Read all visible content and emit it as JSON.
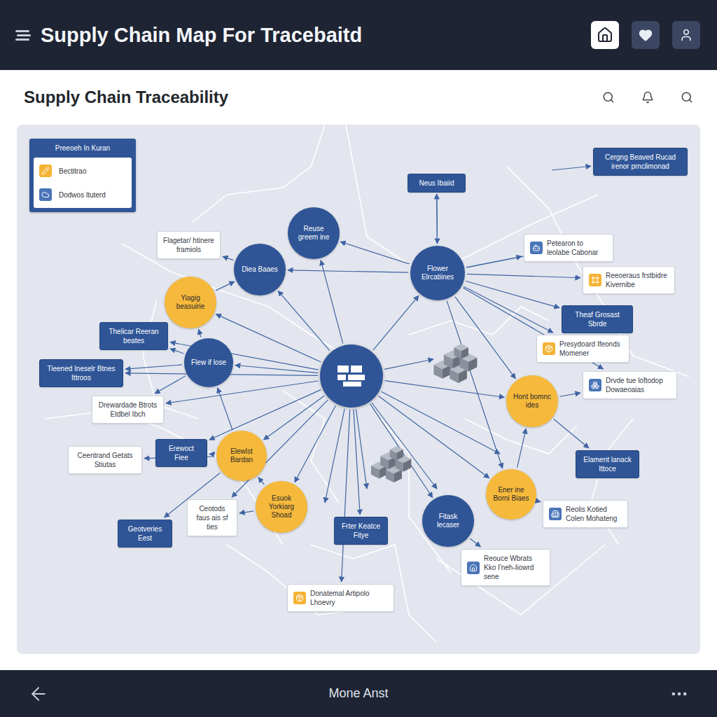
{
  "header": {
    "title": "Supply Chain Map For Tracebaitd"
  },
  "page": {
    "title": "Supply Chain Traceability"
  },
  "legend": {
    "title": "Preeoeh In Kuran",
    "items": [
      {
        "label": "Bectitrao",
        "color": "#f5b335"
      },
      {
        "label": "Dodwos ltuterd",
        "color": "#4a74b8"
      }
    ]
  },
  "circles": [
    {
      "label": "Reuse greem ine",
      "color": "#2f5597"
    },
    {
      "label": "Diea Baaes",
      "color": "#2f5597"
    },
    {
      "label": "Flower Elrcatiines",
      "color": "#2f5597"
    },
    {
      "label": "Yiagig beasuirie",
      "color": "#f6b93b"
    },
    {
      "label": "Flew if lose",
      "color": "#2f5597"
    },
    {
      "label": "Hont bomnc ides",
      "color": "#f6b93b"
    },
    {
      "label": "Elewlst Bardan",
      "color": "#f6b93b"
    },
    {
      "label": "Esuok Yorkiarg Shoad",
      "color": "#f6b93b"
    },
    {
      "label": "Ener ine Borni Biaes",
      "color": "#f6b93b"
    },
    {
      "label": "Fitask lecaser",
      "color": "#2f5597"
    }
  ],
  "labels": [
    {
      "text": "Neus Ibaiid",
      "kind": "dark"
    },
    {
      "text": "Cergng Beaved Rucad irenor prnclimonad",
      "kind": "dark"
    },
    {
      "text": "Flagetar/ htinere framiols",
      "kind": "plain"
    },
    {
      "text": "Petearon to leolabe Cabonar",
      "kind": "icon",
      "color": "#4a74b8"
    },
    {
      "text": "Reeoeraus frstbidre Kivernibe",
      "kind": "icon",
      "color": "#f5b335"
    },
    {
      "text": "Theaf Grosast Sbrde",
      "kind": "dark"
    },
    {
      "text": "Thelicar Reeran beates",
      "kind": "dark"
    },
    {
      "text": "Tieened Ineselr Btnes Ittroos",
      "kind": "dark"
    },
    {
      "text": "Presydoard Ifeonds Momener",
      "kind": "icon",
      "color": "#f5b335"
    },
    {
      "text": "Drvde tue loftodop Dowaeoaias",
      "kind": "icon",
      "color": "#4a74b8"
    },
    {
      "text": "Drewardade Btrots Etdbel Ibch",
      "kind": "plain"
    },
    {
      "text": "Erewoct Fiee",
      "kind": "dark"
    },
    {
      "text": "Ceentrand Getats Stiutas",
      "kind": "plain"
    },
    {
      "text": "Elament lanack Ittoce",
      "kind": "dark"
    },
    {
      "text": "Ceotods faus ais sf ties",
      "kind": "plain"
    },
    {
      "text": "Reolis Kotied Colen Mohateng",
      "kind": "icon",
      "color": "#4a74b8"
    },
    {
      "text": "Geotveries Eest",
      "kind": "dark"
    },
    {
      "text": "Frter Keatce Fitye",
      "kind": "dark"
    },
    {
      "text": "Reouce Wbrats Kko I'neh-Iiowrd sene",
      "kind": "icon",
      "color": "#4a74b8"
    },
    {
      "text": "Donatemal Artipolo Lhoevry",
      "kind": "icon",
      "color": "#f5b335"
    }
  ],
  "footer": {
    "title": "Mone Anst"
  }
}
